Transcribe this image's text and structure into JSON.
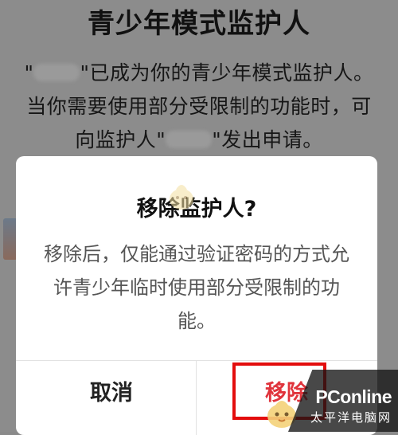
{
  "background": {
    "title": "青少年模式监护人",
    "line1_before": "\"",
    "line1_after": "\"已成为你的青少年模式监护人。",
    "line2": "当你需要使用部分受限制的功能时，可",
    "line3_before": "向监护人\"",
    "line3_after": "\"发出申请。"
  },
  "dialog": {
    "title": "移除监护人?",
    "body": "移除后，仅能通过验证密码的方式允许青少年临时使用部分受限制的功能。",
    "cancel_label": "取消",
    "remove_label": "移除"
  },
  "watermark": {
    "main": "PConline",
    "sub": "太平洋电脑网"
  },
  "colors": {
    "remove": "#e0343c",
    "highlight": "#e30d0d",
    "overlay": "#8c8c8c"
  }
}
